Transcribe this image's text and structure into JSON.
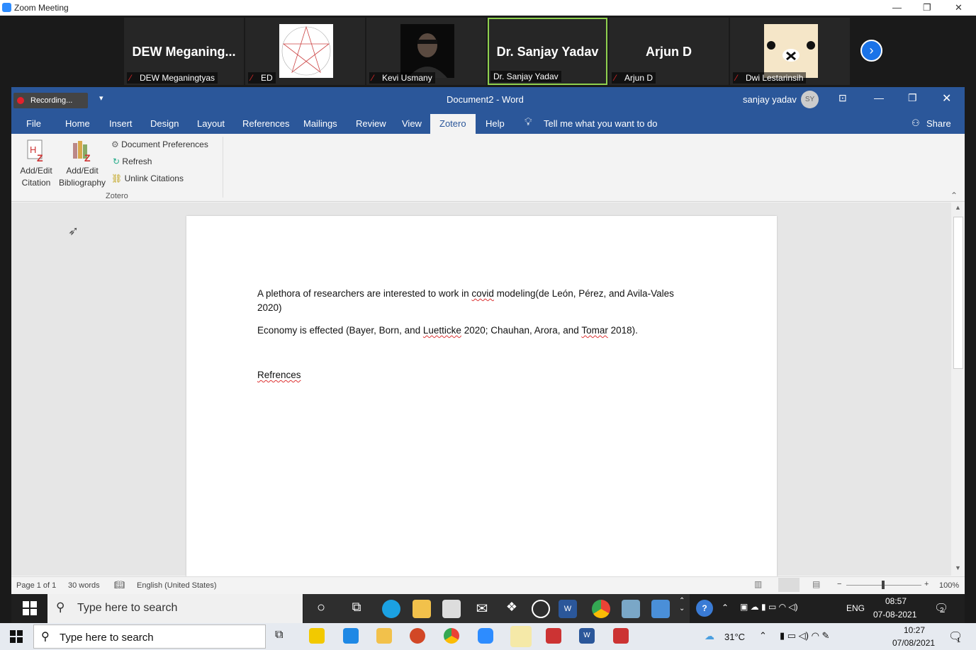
{
  "zoom": {
    "title": "Zoom Meeting",
    "participants": [
      {
        "big_name": "DEW  Meganing...",
        "label": "DEW Meganingtyas",
        "type": "name"
      },
      {
        "big_name": "",
        "label": "ED",
        "type": "star"
      },
      {
        "big_name": "",
        "label": "Kevi Usmany",
        "type": "photo"
      },
      {
        "big_name": "Dr. Sanjay Yadav",
        "label": "Dr. Sanjay Yadav",
        "type": "active"
      },
      {
        "big_name": "Arjun D",
        "label": "Arjun D",
        "type": "name"
      },
      {
        "big_name": "",
        "label": "Dwi Lestarinsih",
        "type": "bear"
      }
    ]
  },
  "word": {
    "recording_label": "Recording...",
    "doc_title": "Document2  -  Word",
    "user": "sanjay yadav",
    "user_initials": "SY",
    "tabs": [
      "File",
      "Home",
      "Insert",
      "Design",
      "Layout",
      "References",
      "Mailings",
      "Review",
      "View",
      "Zotero",
      "Help"
    ],
    "active_tab": "Zotero",
    "tell_me": "Tell me what you want to do",
    "share": "Share",
    "ribbon": {
      "add_edit_citation": [
        "Add/Edit",
        "Citation"
      ],
      "add_edit_bibliography": [
        "Add/Edit",
        "Bibliography"
      ],
      "document_preferences": "Document Preferences",
      "refresh": "Refresh",
      "unlink_citations": "Unlink Citations",
      "group_label": "Zotero"
    },
    "document": {
      "p1_line1_a": "A plethora of researchers are interested to work in ",
      "p1_word_covid": "covid",
      "p1_line1_b": " modeling(de León, Pérez, and Avila-Vales",
      "p1_line2": "2020)",
      "p2_a": "Economy is effected (Bayer, Born, and ",
      "p2_luetticke": "Luetticke",
      "p2_b": " 2020; Chauhan, Arora, and ",
      "p2_tomar": "Tomar",
      "p2_c": " 2018).",
      "heading": "Refrences"
    },
    "status": {
      "page": "Page 1 of 1",
      "words": "30 words",
      "language": "English (United States)",
      "zoom": "100%"
    }
  },
  "inner_taskbar": {
    "search_placeholder": "Type here to search",
    "weather": "",
    "lang": "ENG",
    "time": "08:57",
    "date": "07-08-2021",
    "notif": "2"
  },
  "outer_taskbar": {
    "search_placeholder": "Type here to search",
    "temperature": "31°C",
    "time": "10:27",
    "date": "07/08/2021",
    "notif": "1"
  },
  "colors": {
    "word_blue": "#2b579a",
    "zoom_blue": "#2d8cff",
    "active_speaker": "#8fd14f",
    "muted_red": "#e02828"
  }
}
